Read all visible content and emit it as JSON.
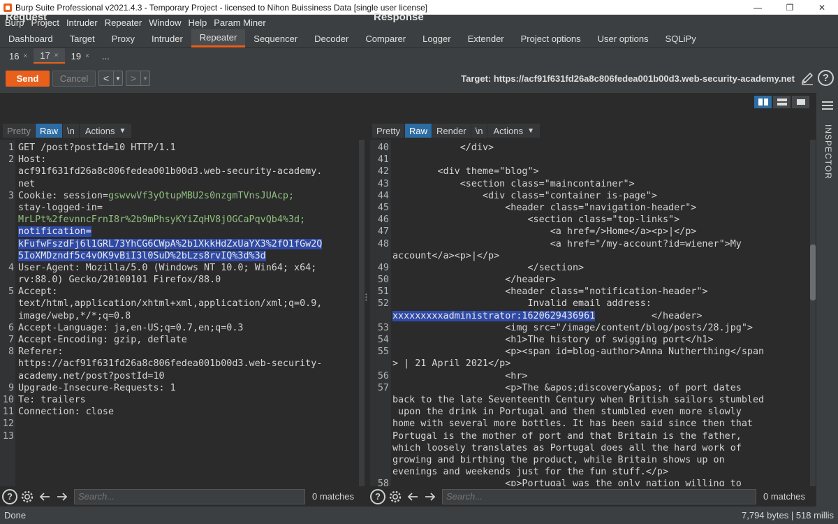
{
  "window": {
    "title": "Burp Suite Professional v2021.4.3 - Temporary Project - licensed to Nihon Buissiness Data [single user license]",
    "minimize": "—",
    "maximize": "❐",
    "close": "✕"
  },
  "menu": [
    "Burp",
    "Project",
    "Intruder",
    "Repeater",
    "Window",
    "Help",
    "Param Miner"
  ],
  "main_tabs": [
    "Dashboard",
    "Target",
    "Proxy",
    "Intruder",
    "Repeater",
    "Sequencer",
    "Decoder",
    "Comparer",
    "Logger",
    "Extender",
    "Project options",
    "User options",
    "SQLiPy"
  ],
  "main_tab_active": "Repeater",
  "sub_tabs": [
    {
      "label": "16",
      "close": "×"
    },
    {
      "label": "17",
      "close": "×"
    },
    {
      "label": "19",
      "close": "×"
    },
    {
      "label": "...",
      "close": ""
    }
  ],
  "toolbar": {
    "send": "Send",
    "cancel": "Cancel",
    "back": "<",
    "forward": ">",
    "dropdown": "▼",
    "target": "Target: https://acf91f631fd26a8c806fedea001b00d3.web-security-academy.net",
    "help": "?"
  },
  "request": {
    "title": "Request",
    "views": [
      "Pretty",
      "Raw",
      "\\n",
      "Actions"
    ],
    "gutter": [
      "1",
      "2",
      "",
      "",
      "3",
      "",
      "",
      "",
      "",
      "",
      "4",
      "",
      "5",
      "",
      "",
      "6",
      "7",
      "8",
      "",
      "",
      "9",
      "10",
      "11",
      "12",
      "13"
    ],
    "lines": [
      "GET /post?postId=10 HTTP/1.1",
      "Host:",
      "acf91f631fd26a8c806fedea001b00d3.web-security-academy.",
      "net",
      "Cookie: session=",
      "gswvwVf3yOtupMBU2s0nzgmTVnsJUAcp;",
      "stay-logged-in=",
      "MrLPt%2fevnncFrnI8r%2b9mPhsyKYiZqHV8jOGCaPqvQb4%3d;",
      "notification=",
      "kFufwFszdFj6l1GRL73YhCG6CWpA%2b1XkkHdZxUaYX3%2fO1fGw2Q5IoXMDzndf5c4vOK9vBiI3l0SuD%2bLzs8rvIQ%3d%3d",
      "User-Agent: Mozilla/5.0 (Windows NT 10.0; Win64; x64;",
      "rv:88.0) Gecko/20100101 Firefox/88.0",
      "Accept:",
      "text/html,application/xhtml+xml,application/xml;q=0.9,",
      "image/webp,*/*;q=0.8",
      "Accept-Language: ja,en-US;q=0.7,en;q=0.3",
      "Accept-Encoding: gzip, deflate",
      "Referer:",
      "https://acf91f631fd26a8c806fedea001b00d3.web-security-",
      "academy.net/post?postId=10",
      "Upgrade-Insecure-Requests: 1",
      "Te: trailers",
      "Connection: close"
    ]
  },
  "response": {
    "title": "Response",
    "views": [
      "Pretty",
      "Raw",
      "Render",
      "\\n",
      "Actions"
    ],
    "gutter": [
      "40",
      "41",
      "42",
      "43",
      "44",
      "45",
      "46",
      "47",
      "48",
      "",
      "49",
      "50",
      "51",
      "52",
      "",
      "53",
      "54",
      "55",
      "",
      "56",
      "57",
      "",
      "",
      "",
      "",
      "",
      "",
      "",
      "58"
    ],
    "lines": [
      "            </div>",
      "",
      "        <div theme=\"blog\">",
      "            <section class=\"maincontainer\">",
      "                <div class=\"container is-page\">",
      "                    <header class=\"navigation-header\">",
      "                        <section class=\"top-links\">",
      "                            <a href=/>Home</a><p>|</p>",
      "                            <a href=\"/my-account?id=wiener\">My",
      "account</a><p>|</p>",
      "                        </section>",
      "                    </header>",
      "                    <header class=\"notification-header\">",
      "                        Invalid email address:",
      "xxxxxxxxxadministrator:1620629436961",
      "                    <img src=\"/image/content/blog/posts/28.jpg\">",
      "                    <h1>The history of swigging port</h1>",
      "                    <p><span id=blog-author>Anna Nutherthing</span",
      "> | 21 April 2021</p>",
      "                    <hr>",
      "                    <p>The &apos;discovery&apos; of port dates",
      "back to the late Seventeenth Century when British sailors stumbled",
      " upon the drink in Portugal and then stumbled even more slowly",
      "home with several more bottles. It has been said since then that",
      "Portugal is the mother of port and that Britain is the father,",
      "which loosely translates as Portugal does all the hard work of",
      "growing and birthing the product, while Britain shows up on",
      "evenings and weekends just for the fun stuff.</p>",
      "                    <p>Portugal was the only nation willing to"
    ],
    "header_close": "</header>"
  },
  "search": {
    "placeholder": "Search...",
    "matches": "0 matches",
    "help": "?"
  },
  "inspector": {
    "label": "INSPECTOR"
  },
  "status": {
    "left": "Done",
    "right": "7,794 bytes | 518 millis"
  },
  "colors": {
    "accent": "#e8601c",
    "selection": "#2f4aa6",
    "active_view": "#2d6ca2"
  }
}
